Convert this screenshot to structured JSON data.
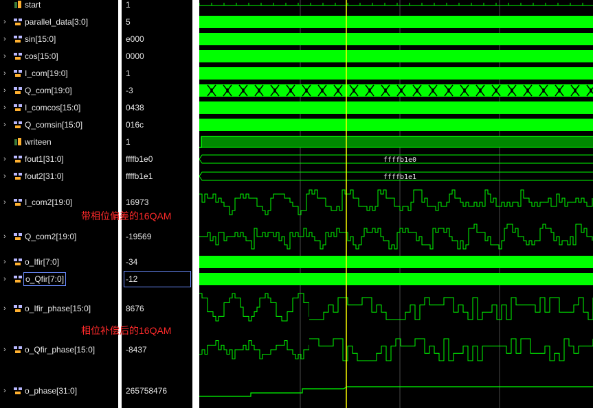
{
  "signals": [
    {
      "name": "start",
      "value": "1",
      "kind": "bit",
      "expandable": false
    },
    {
      "name": "parallel_data[3:0]",
      "value": "5",
      "kind": "bus",
      "expandable": true
    },
    {
      "name": "sin[15:0]",
      "value": "e000",
      "kind": "bus",
      "expandable": true
    },
    {
      "name": "cos[15:0]",
      "value": "0000",
      "kind": "bus",
      "expandable": true
    },
    {
      "name": "I_com[19:0]",
      "value": "1",
      "kind": "bus",
      "expandable": true
    },
    {
      "name": "Q_com[19:0]",
      "value": "-3",
      "kind": "bus",
      "expandable": true
    },
    {
      "name": "I_comcos[15:0]",
      "value": "0438",
      "kind": "bus",
      "expandable": true
    },
    {
      "name": "Q_comsin[15:0]",
      "value": "016c",
      "kind": "bus",
      "expandable": true
    },
    {
      "name": "writeen",
      "value": "1",
      "kind": "bit",
      "expandable": false
    },
    {
      "name": "fout1[31:0]",
      "value": "ffffb1e0",
      "kind": "bus",
      "expandable": true
    },
    {
      "name": "fout2[31:0]",
      "value": "ffffb1e1",
      "kind": "bus",
      "expandable": true
    },
    {
      "name": "I_com2[19:0]",
      "value": "16973",
      "kind": "analog",
      "expandable": true
    },
    {
      "name": "Q_com2[19:0]",
      "value": "-19569",
      "kind": "analog",
      "expandable": true
    },
    {
      "name": "o_Ifir[7:0]",
      "value": "-34",
      "kind": "bus",
      "expandable": true
    },
    {
      "name": "o_Qfir[7:0]",
      "value": "-12",
      "kind": "bus",
      "expandable": true,
      "selected": true
    },
    {
      "name": "o_Ifir_phase[15:0]",
      "value": "8676",
      "kind": "analog",
      "expandable": true
    },
    {
      "name": "o_Qfir_phase[15:0]",
      "value": "-8437",
      "kind": "analog",
      "expandable": true
    },
    {
      "name": "o_phase[31:0]",
      "value": "265758476",
      "kind": "analog",
      "expandable": true
    }
  ],
  "bus_labels": {
    "fout1": "ffffb1e0",
    "fout2": "ffffb1e1"
  },
  "annotations": [
    {
      "text": "带相位偏差的16QAM"
    },
    {
      "text": "相位补偿后的16QAM"
    }
  ],
  "colors": {
    "background": "#000000",
    "wave": "#00ff00",
    "wave_dark": "#008800",
    "cursor": "#ffff00",
    "grid": "#4a4a4a",
    "annotation": "#ff2a2a",
    "selection_border": "#6b8cff",
    "separator": "#ffffff",
    "bit_icon": "#ffb030",
    "bus_icon": "#b8b8ff"
  },
  "icons": {
    "expand": "chevron-right-icon",
    "bus": "bus-signal-icon",
    "bit": "bit-signal-icon"
  }
}
